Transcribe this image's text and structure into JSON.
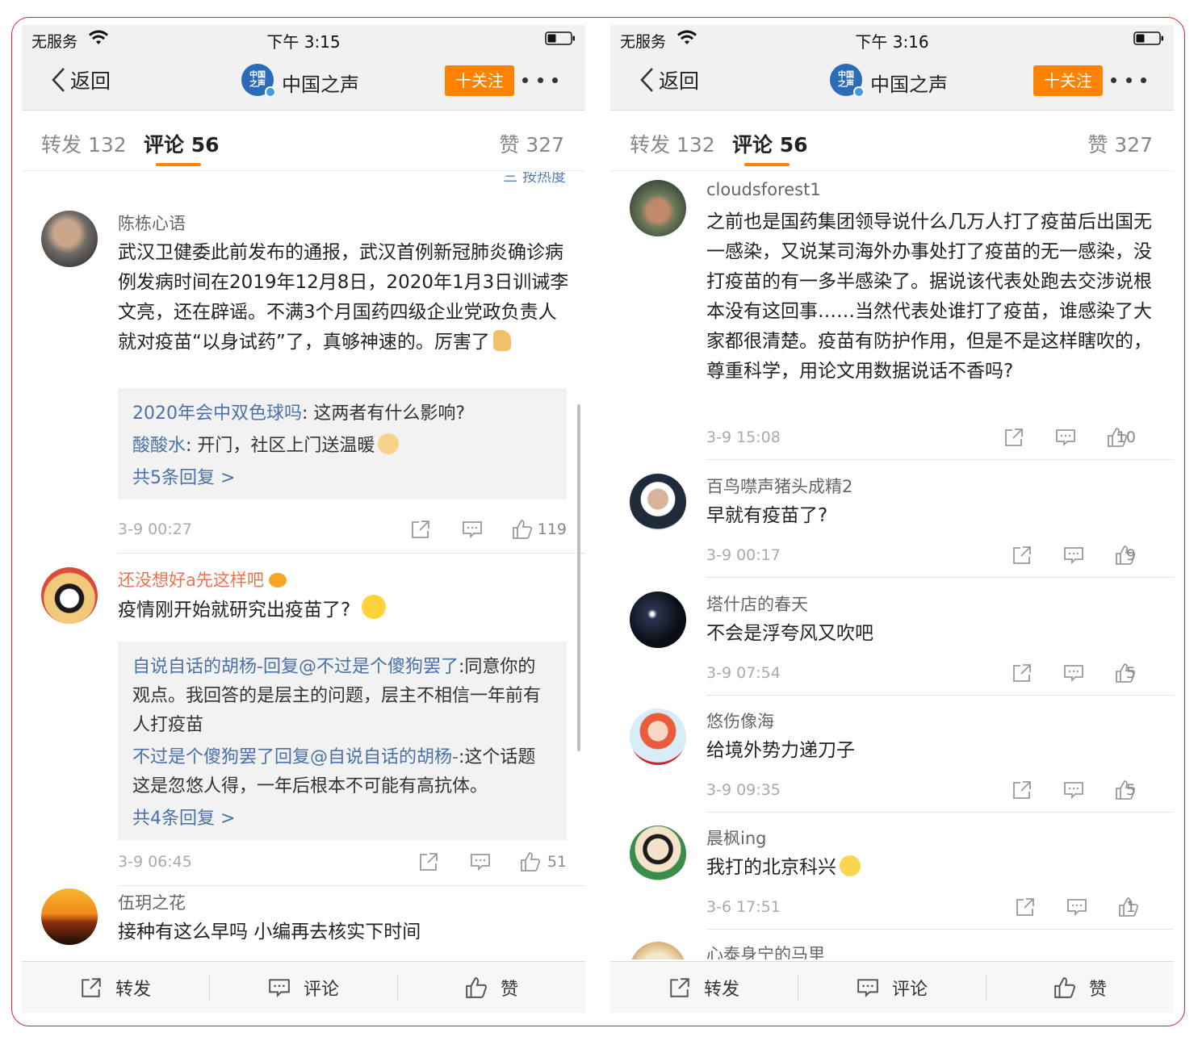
{
  "colors": {
    "accent": "#ff8200",
    "link": "#4a72a8",
    "frame": "#cf2a2a",
    "vip_name": "#eb7350"
  },
  "icons": [
    "wifi-icon",
    "battery-icon",
    "back-chevron-icon",
    "repost-icon",
    "comment-icon",
    "like-icon"
  ],
  "left": {
    "status": {
      "carrier": "无服务",
      "time": "下午 3:15"
    },
    "nav": {
      "back": "返回",
      "logo": "中国之声",
      "title": "中国之声",
      "follow": "十关注"
    },
    "tabs": {
      "repost": "转发 132",
      "comment": "评论 56",
      "like": "赞 327"
    },
    "hot_sort": "三 按热度",
    "comments": [
      {
        "author": "陈栋心语",
        "text": "武汉卫健委此前发布的通报，武汉首例新冠肺炎确诊病例发病时间在2019年12月8日，2020年1月3日训诫李文亮，还在辟谣。不满3个月国药四级企业党政负责人就对疫苗“以身试药”了，真够神速的。厉害了",
        "replies": [
          {
            "user": "2020年会中双色球吗",
            "text": ": 这两者有什么影响?"
          },
          {
            "user": "酸酸水",
            "text": ": 开门，社区上门送温暖"
          }
        ],
        "more": "共5条回复 >",
        "time": "3-9 00:27",
        "likes": "119"
      },
      {
        "author": "还没想好a先这样吧",
        "text": "疫情刚开始就研究出疫苗了?",
        "replies": [
          {
            "user": "自说自话的胡杨-回复@不过是个傻狗罢了",
            "text": ":同意你的观点。我回答的是层主的问题，层主不相信一年前有人打疫苗"
          },
          {
            "user": "不过是个傻狗罢了回复@自说自话的胡杨-",
            "text": ":这个话题这是忽悠人得，一年后根本不可能有高抗体。"
          }
        ],
        "more": "共4条回复 >",
        "time": "3-9 06:45",
        "likes": "51"
      },
      {
        "author": "伍玥之花",
        "text": "接种有这么早吗 小编再去核实下时间"
      }
    ],
    "toolbar": {
      "repost": "转发",
      "comment": "评论",
      "like": "赞"
    }
  },
  "right": {
    "status": {
      "carrier": "无服务",
      "time": "下午 3:16"
    },
    "nav": {
      "back": "返回",
      "logo": "中国之声",
      "title": "中国之声",
      "follow": "十关注"
    },
    "tabs": {
      "repost": "转发 132",
      "comment": "评论 56",
      "like": "赞 327"
    },
    "comments": [
      {
        "author": "cloudsforest1",
        "text": "之前也是国药集团领导说什么几万人打了疫苗后出国无一感染，又说某司海外办事处打了疫苗的无一感染，没打疫苗的有一多半感染了。据说该代表处跑去交涉说根本没有这回事……当然代表处谁打了疫苗，谁感染了大家都很清楚。疫苗有防护作用，但是不是这样瞎吹的，尊重科学，用论文用数据说话不香吗?",
        "time": "3-9 15:08",
        "likes": "10"
      },
      {
        "author": "百鸟噤声猪头成精2",
        "text": "早就有疫苗了?",
        "time": "3-9 00:17",
        "likes": "9"
      },
      {
        "author": "塔什店的春天",
        "text": "不会是浮夸风又吹吧",
        "time": "3-9 07:54",
        "likes": "5"
      },
      {
        "author": "悠伤像海",
        "text": "给境外势力递刀子",
        "time": "3-9 09:35",
        "likes": "5"
      },
      {
        "author": "晨枫ing",
        "text": "我打的北京科兴",
        "time": "3-6 17:51",
        "likes": "1"
      },
      {
        "author": "心泰身宁的马里"
      }
    ],
    "toolbar": {
      "repost": "转发",
      "comment": "评论",
      "like": "赞"
    }
  }
}
